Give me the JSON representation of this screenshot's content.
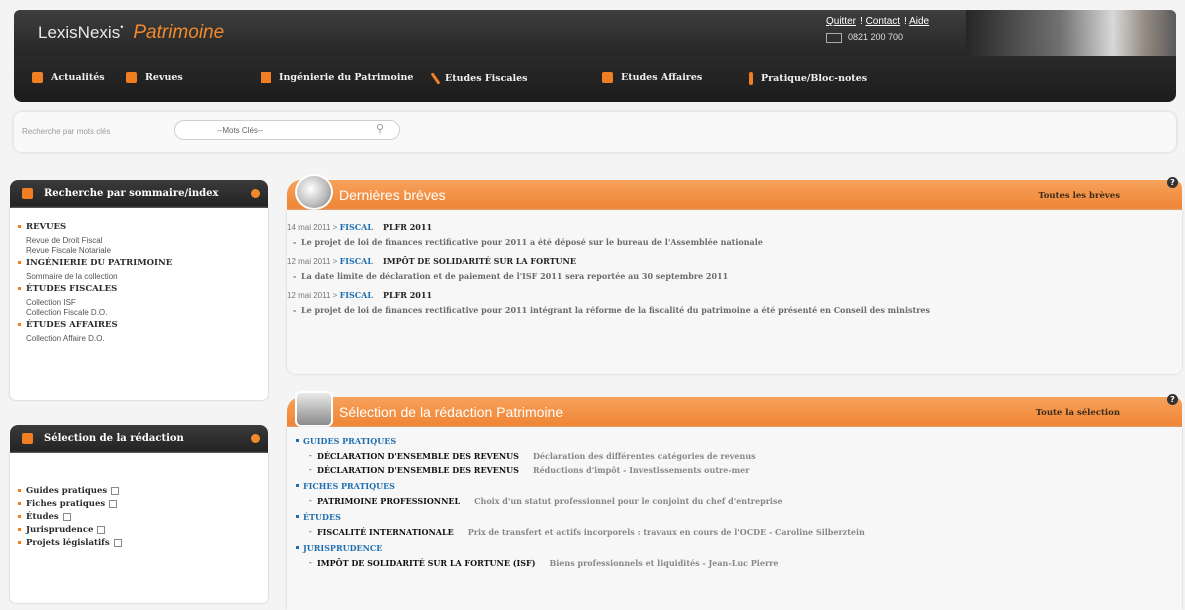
{
  "header": {
    "logo": "LexisNexis",
    "brand": "Patrimoine",
    "links": [
      "Quitter",
      "Contact",
      "Aide"
    ],
    "phone": "0821 200 700"
  },
  "nav": {
    "items": [
      {
        "label": "Actualités"
      },
      {
        "label": "Revues"
      },
      {
        "label": "Ingénierie du Patrimoine"
      },
      {
        "label": "Etudes Fiscales"
      },
      {
        "label": "Etudes Affaires"
      },
      {
        "label": "Pratique/Bloc-notes"
      }
    ]
  },
  "search": {
    "label": "Recherche par mots clés",
    "placeholder": "--Mots Clés--"
  },
  "sommaire": {
    "title": "Recherche par sommaire/index",
    "sections": [
      {
        "title": "REVUES",
        "items": [
          "Revue de Droit Fiscal",
          "Revue Fiscale Notariale"
        ]
      },
      {
        "title": "INGÉNIERIE DU PATRIMOINE",
        "items": [
          "Sommaire de la collection"
        ]
      },
      {
        "title": "ÉTUDES FISCALES",
        "items": [
          "Collection ISF",
          "Collection Fiscale D.O."
        ]
      },
      {
        "title": "ÉTUDES AFFAIRES",
        "items": [
          "Collection Affaire D.O."
        ]
      }
    ]
  },
  "selection_left": {
    "title": "Sélection de la rédaction",
    "items": [
      "Guides pratiques",
      "Fiches pratiques",
      "Études",
      "Jurisprudence",
      "Projets législatifs"
    ]
  },
  "breves": {
    "title": "Dernières brèves",
    "more": "Toutes les brèves",
    "help": "?",
    "items": [
      {
        "date": "14 mai 2011 >",
        "category": "FISCAL",
        "headline": "PLFR 2011",
        "text": "Le projet de loi de finances rectificative pour 2011 a été déposé sur le bureau de l'Assemblée nationale"
      },
      {
        "date": "12 mai 2011 >",
        "category": "FISCAL",
        "headline": "IMPÔT DE SOLIDARITÉ SUR LA FORTUNE",
        "text": "La date limite de déclaration et de paiement de l'ISF 2011 sera reportée au 30 septembre 2011"
      },
      {
        "date": "12 mai 2011 >",
        "category": "FISCAL",
        "headline": "PLFR 2011",
        "text": "Le projet de loi de finances rectificative pour 2011 intégrant la réforme de la fiscalité du patrimoine a été présenté en Conseil des ministres"
      }
    ]
  },
  "selection": {
    "title": "Sélection de la rédaction Patrimoine",
    "more": "Toute la sélection",
    "help": "?",
    "groups": [
      {
        "category": "GUIDES PRATIQUES",
        "items": [
          {
            "title": "DÉCLARATION D'ENSEMBLE DES REVENUS",
            "desc": "Déclaration des différentes catégories de revenus"
          },
          {
            "title": "DÉCLARATION D'ENSEMBLE DES REVENUS",
            "desc": "Réductions d'impôt - Investissements outre-mer"
          }
        ]
      },
      {
        "category": "FICHES PRATIQUES",
        "items": [
          {
            "title": "PATRIMOINE PROFESSIONNEL",
            "desc": "Choix d'un statut professionnel pour le conjoint du chef d'entreprise"
          }
        ]
      },
      {
        "category": "ÉTUDES",
        "items": [
          {
            "title": "FISCALITÉ INTERNATIONALE",
            "desc": "Prix de transfert et actifs incorporels : travaux en cours de l'OCDE - Caroline Silberztein"
          }
        ]
      },
      {
        "category": "JURISPRUDENCE",
        "items": [
          {
            "title": "IMPÔT DE SOLIDARITÉ SUR LA FORTUNE (ISF)",
            "desc": "Biens professionnels et liquidités - Jean-Luc Pierre"
          }
        ]
      }
    ]
  },
  "colors": {
    "accent": "#f07f24",
    "dark": "#262626",
    "link": "#1f6fb0"
  }
}
